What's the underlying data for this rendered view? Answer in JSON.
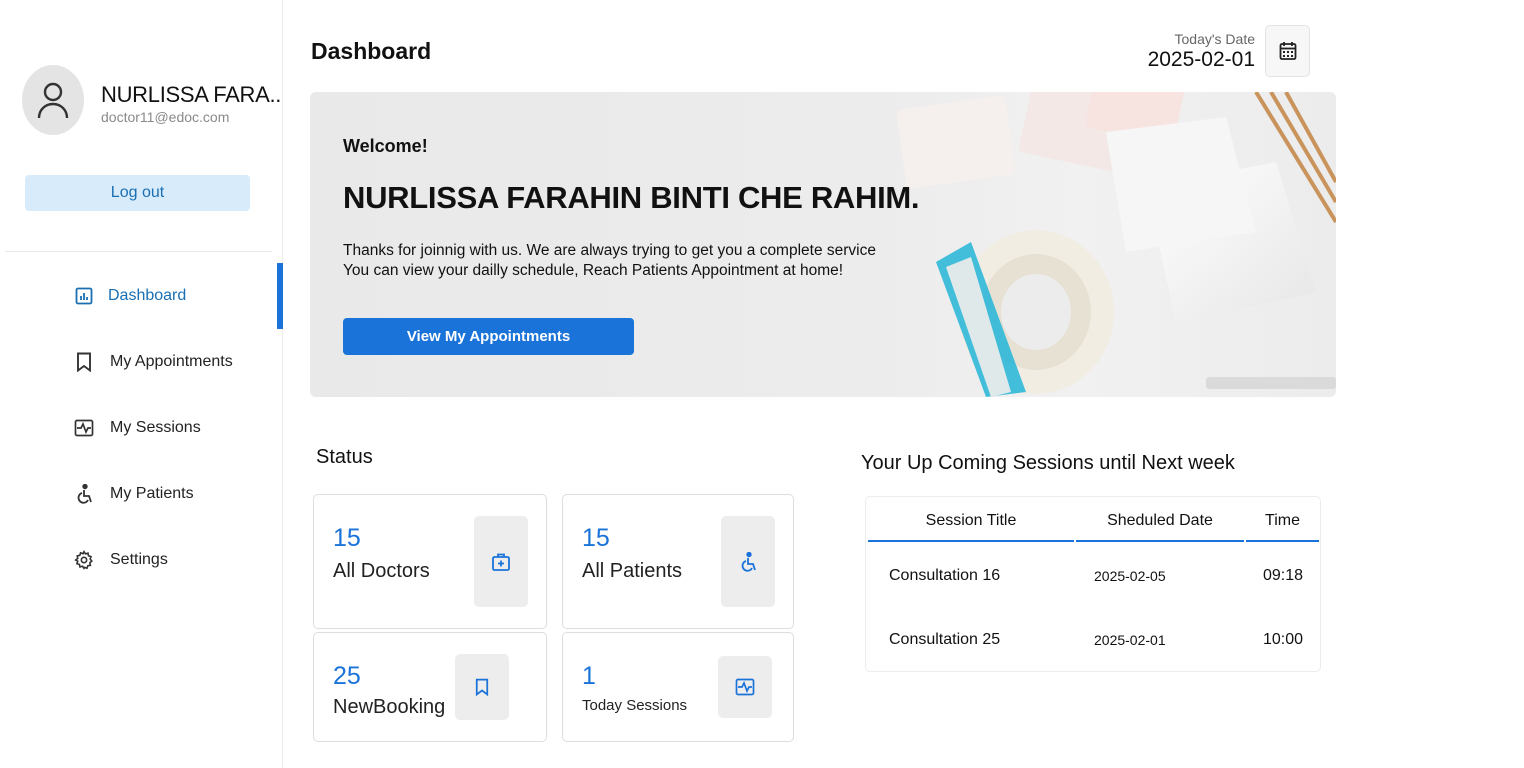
{
  "profile": {
    "name": "NURLISSA FARA..",
    "email": "doctor11@edoc.com",
    "logout_label": "Log out"
  },
  "sidebar": {
    "items": [
      {
        "label": "Dashboard",
        "icon": "dashboard-icon",
        "active": true
      },
      {
        "label": "My Appointments",
        "icon": "bookmark-icon",
        "active": false
      },
      {
        "label": "My Sessions",
        "icon": "sessions-icon",
        "active": false
      },
      {
        "label": "My Patients",
        "icon": "wheelchair-icon",
        "active": false
      },
      {
        "label": "Settings",
        "icon": "gear-icon",
        "active": false
      }
    ]
  },
  "header": {
    "title": "Dashboard",
    "date_label": "Today's Date",
    "date_value": "2025-02-01"
  },
  "banner": {
    "welcome": "Welcome!",
    "doctor_name": "NURLISSA FARAHIN BINTI CHE RAHIM.",
    "line1": "Thanks for joinnig with us. We are always trying to get you a complete service",
    "line2": "You can view your dailly schedule, Reach Patients Appointment at home!",
    "button_label": "View My Appointments"
  },
  "status": {
    "title": "Status",
    "cards": [
      {
        "number": "15",
        "label": "All Doctors",
        "icon": "medical-kit-icon"
      },
      {
        "number": "15",
        "label": "All Patients",
        "icon": "wheelchair-icon"
      },
      {
        "number": "25",
        "label": "NewBooking",
        "icon": "bookmark-icon"
      },
      {
        "number": "1",
        "label": "Today Sessions",
        "icon": "sessions-icon"
      }
    ]
  },
  "sessions": {
    "title": "Your Up Coming Sessions until Next week",
    "columns": [
      "Session Title",
      "Sheduled Date",
      "Time"
    ],
    "rows": [
      {
        "title": "Consultation 16",
        "date": "2025-02-05",
        "time": "09:18"
      },
      {
        "title": "Consultation 25",
        "date": "2025-02-01",
        "time": "10:00"
      }
    ]
  },
  "colors": {
    "accent": "#1a73d9",
    "logout_bg": "#d7ebfa",
    "card_border": "#dedede"
  }
}
